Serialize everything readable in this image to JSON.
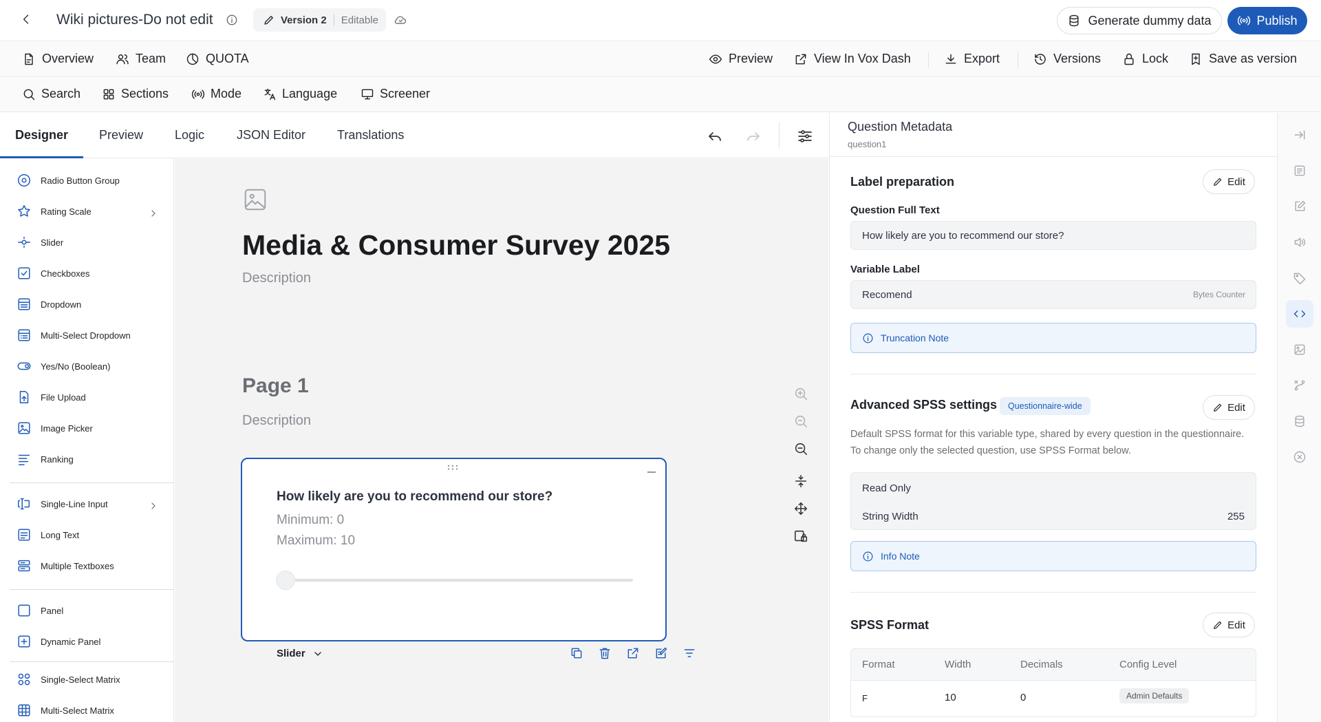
{
  "topbar": {
    "title": "Wiki pictures-Do not edit",
    "version_label": "Version 2",
    "version_state": "Editable",
    "generate_label": "Generate dummy data",
    "publish_label": "Publish"
  },
  "nav": {
    "overview": "Overview",
    "team": "Team",
    "quota": "QUOTA",
    "preview": "Preview",
    "view_vox": "View In Vox Dash",
    "export": "Export",
    "versions": "Versions",
    "lock": "Lock",
    "save_version": "Save as version"
  },
  "tools": {
    "search": "Search",
    "sections": "Sections",
    "mode": "Mode",
    "language": "Language",
    "screener": "Screener"
  },
  "tabs": [
    "Designer",
    "Preview",
    "Logic",
    "JSON Editor",
    "Translations"
  ],
  "palette": {
    "items": [
      {
        "label": "Radio Button Group",
        "icon": "radio-icon"
      },
      {
        "label": "Rating Scale",
        "icon": "star-icon"
      },
      {
        "label": "Slider",
        "icon": "slider-icon"
      },
      {
        "label": "Checkboxes",
        "icon": "checkbox-icon"
      },
      {
        "label": "Dropdown",
        "icon": "dropdown-icon"
      },
      {
        "label": "Multi-Select Dropdown",
        "icon": "multiselect-icon"
      },
      {
        "label": "Yes/No (Boolean)",
        "icon": "toggle-icon"
      },
      {
        "label": "File Upload",
        "icon": "upload-icon"
      },
      {
        "label": "Image Picker",
        "icon": "image-picker-icon"
      },
      {
        "label": "Ranking",
        "icon": "ranking-icon"
      },
      {
        "label": "Single-Line Input",
        "icon": "text-input-icon"
      },
      {
        "label": "Long Text",
        "icon": "long-text-icon"
      },
      {
        "label": "Multiple Textboxes",
        "icon": "multi-textbox-icon"
      },
      {
        "label": "Panel",
        "icon": "panel-icon"
      },
      {
        "label": "Dynamic Panel",
        "icon": "dynamic-panel-icon"
      },
      {
        "label": "Single-Select Matrix",
        "icon": "matrix-icon"
      },
      {
        "label": "Multi-Select Matrix",
        "icon": "grid-icon"
      }
    ]
  },
  "canvas": {
    "survey_title": "Media & Consumer Survey 2025",
    "survey_description": "Description",
    "page_title": "Page 1",
    "page_description": "Description",
    "question": {
      "title": "How likely are you to recommend our store?",
      "min_text": "Minimum: 0",
      "max_text": "Maximum: 10",
      "slider_value": 0,
      "type_label": "Slider"
    }
  },
  "metadata": {
    "title": "Question Metadata",
    "subtitle": "question1",
    "label_prep": {
      "title": "Label preparation",
      "edit": "Edit",
      "full_text_label": "Question Full Text",
      "full_text_value": "How likely are you to recommend our store?",
      "var_label_label": "Variable Label",
      "var_label_value": "Recomend",
      "bytes_hint": "Bytes Counter",
      "truncation_note": "Truncation Note"
    },
    "advanced": {
      "title": "Advanced SPSS settings",
      "badge": "Questionnaire-wide",
      "edit": "Edit",
      "description": "Default SPSS format for this variable type, shared by every question in the questionnaire. To change only the selected question, use SPSS Format below.",
      "read_only": "Read Only",
      "string_width_label": "String Width",
      "string_width_value": "255",
      "info_note": "Info Note"
    },
    "spss_format": {
      "title": "SPSS Format",
      "edit": "Edit",
      "headers": [
        "Format",
        "Width",
        "Decimals",
        "Config Level"
      ],
      "row": {
        "format": "F",
        "width": "10",
        "decimals": "0",
        "config_level": "Admin Defaults"
      }
    }
  },
  "colors": {
    "accent": "#1e5bb8",
    "canvas_bg": "#f3f3f3"
  }
}
